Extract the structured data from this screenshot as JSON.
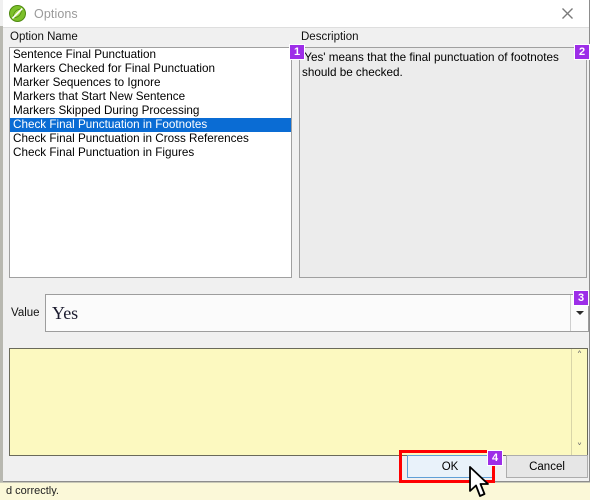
{
  "window": {
    "title": "Options",
    "icon": "leaf-slash-icon",
    "close_label": "✕",
    "accent_badge_color": "#9d2ee8",
    "selection_color": "#0a6cd4",
    "highlight_color": "#ff0000"
  },
  "labels": {
    "option_name": "Option Name",
    "description": "Description",
    "value": "Value"
  },
  "option_list": {
    "items": [
      {
        "label": "Sentence Final Punctuation",
        "selected": false
      },
      {
        "label": "Markers Checked for Final Punctuation",
        "selected": false
      },
      {
        "label": "Marker Sequences to Ignore",
        "selected": false
      },
      {
        "label": "Markers that Start New Sentence",
        "selected": false
      },
      {
        "label": "Markers Skipped During Processing",
        "selected": false
      },
      {
        "label": "Check Final Punctuation in Footnotes",
        "selected": true
      },
      {
        "label": "Check Final Punctuation in Cross References",
        "selected": false
      },
      {
        "label": "Check Final Punctuation in Figures",
        "selected": false
      }
    ]
  },
  "description": {
    "text": "'Yes' means that the final punctuation of footnotes should be checked."
  },
  "value_field": {
    "value": "Yes",
    "dropdown_icon": "chevron-down-icon"
  },
  "notes_area": {
    "text": "",
    "scroll_up_icon": "˄",
    "scroll_down_icon": "˅"
  },
  "buttons": {
    "ok": "OK",
    "cancel": "Cancel"
  },
  "badges": {
    "one": "1",
    "two": "2",
    "three": "3",
    "four": "4"
  },
  "background": {
    "status_text": "d correctly."
  }
}
